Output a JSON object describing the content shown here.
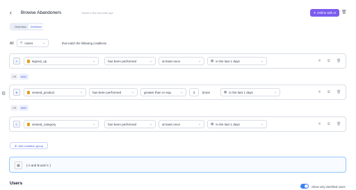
{
  "header": {
    "title": "Browse Abandoners",
    "saved_text": "Saved a few seconds ago",
    "ai_button_label": "Define with AI"
  },
  "tabs": [
    {
      "label": "Overview"
    },
    {
      "label": "Definition"
    }
  ],
  "match_row": {
    "all_label": "All",
    "users_label": "Users",
    "suffix_text": "that match the following conditions"
  },
  "conditions": [
    {
      "letter": "A",
      "event": "signed_up",
      "action": "has been performed",
      "frequency": "at least once",
      "time": "in the last 1 days"
    },
    {
      "letter": "B",
      "event": "viewed_product",
      "action": "has been performed",
      "frequency": "greater than or equ",
      "count": "3",
      "count_unit": "times",
      "time": "in the last 1 days"
    },
    {
      "letter": "C",
      "event": "viewed_category",
      "action": "has been performed",
      "frequency": "at least once",
      "time": "in the last 1 days"
    }
  ],
  "connectors": [
    {
      "or": "OR",
      "and": "AND"
    },
    {
      "or": "OR",
      "and": "AND"
    }
  ],
  "add_group_label": "Add condition group",
  "expression": "( A and B and C )",
  "users_section": {
    "heading": "Users",
    "toggle_label": "Show only identified users"
  },
  "colors": {
    "accent": "#7c5cf0",
    "link": "#3b5bdb",
    "border": "#d9dee6"
  }
}
